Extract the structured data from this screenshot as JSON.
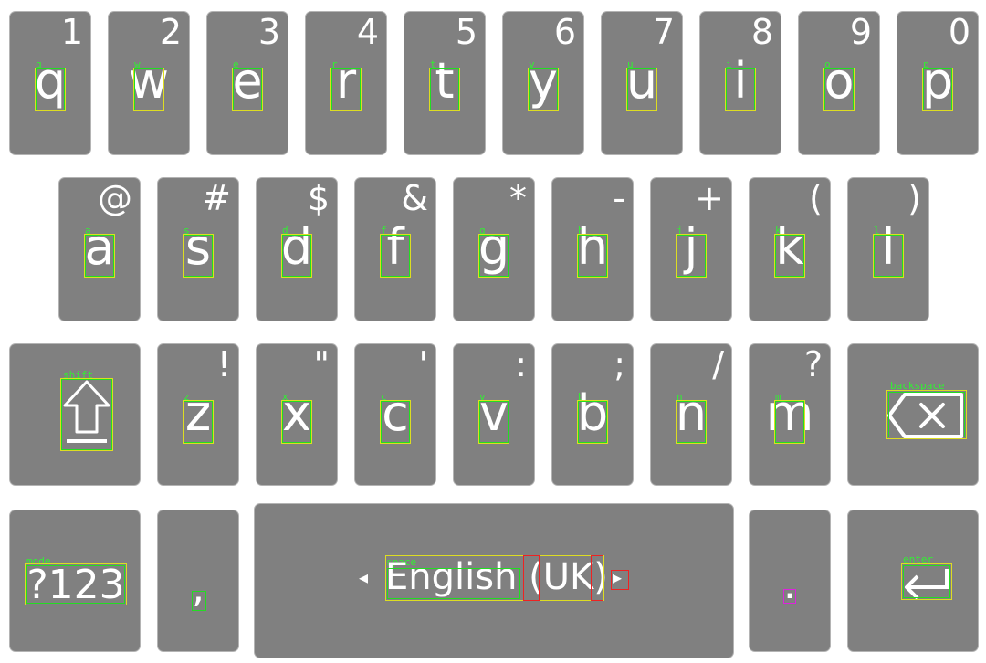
{
  "keyboard": {
    "row1": [
      {
        "hint": "1",
        "letter": "q"
      },
      {
        "hint": "2",
        "letter": "w"
      },
      {
        "hint": "3",
        "letter": "e"
      },
      {
        "hint": "4",
        "letter": "r"
      },
      {
        "hint": "5",
        "letter": "t"
      },
      {
        "hint": "6",
        "letter": "y"
      },
      {
        "hint": "7",
        "letter": "u"
      },
      {
        "hint": "8",
        "letter": "i"
      },
      {
        "hint": "9",
        "letter": "o"
      },
      {
        "hint": "0",
        "letter": "p"
      }
    ],
    "row2": [
      {
        "hint": "@",
        "letter": "a"
      },
      {
        "hint": "#",
        "letter": "s"
      },
      {
        "hint": "$",
        "letter": "d"
      },
      {
        "hint": "&",
        "letter": "f"
      },
      {
        "hint": "*",
        "letter": "g"
      },
      {
        "hint": "-",
        "letter": "h"
      },
      {
        "hint": "+",
        "letter": "j"
      },
      {
        "hint": "(",
        "letter": "k"
      },
      {
        "hint": ")",
        "letter": "l"
      }
    ],
    "row3": [
      {
        "hint": "!",
        "letter": "z"
      },
      {
        "hint": "\"",
        "letter": "x"
      },
      {
        "hint": "'",
        "letter": "c"
      },
      {
        "hint": ":",
        "letter": "v"
      },
      {
        "hint": ";",
        "letter": "b"
      },
      {
        "hint": "/",
        "letter": "n"
      },
      {
        "hint": "?",
        "letter": "m"
      }
    ],
    "shift": {
      "icon": "shift-arrow-icon",
      "annotation": "shift"
    },
    "backspace": {
      "icon": "backspace-icon",
      "annotation": "backspace"
    },
    "mode": {
      "label": "?123",
      "annotation": "mode"
    },
    "comma": {
      "label": ","
    },
    "space": {
      "label": "English",
      "label_suffix": "(UK)",
      "annotation": "space",
      "left_arrow": "◂",
      "right_arrow": "▸"
    },
    "period": {
      "label": "."
    },
    "enter": {
      "icon": "enter-icon",
      "annotation": "enter"
    }
  },
  "colors": {
    "key_bg": "#808080",
    "key_border": "#b4b4b4",
    "annotation_green": "#22dd22",
    "annotation_yellow": "#dddd22",
    "annotation_red": "#ee2222",
    "annotation_magenta": "#dd22dd"
  }
}
